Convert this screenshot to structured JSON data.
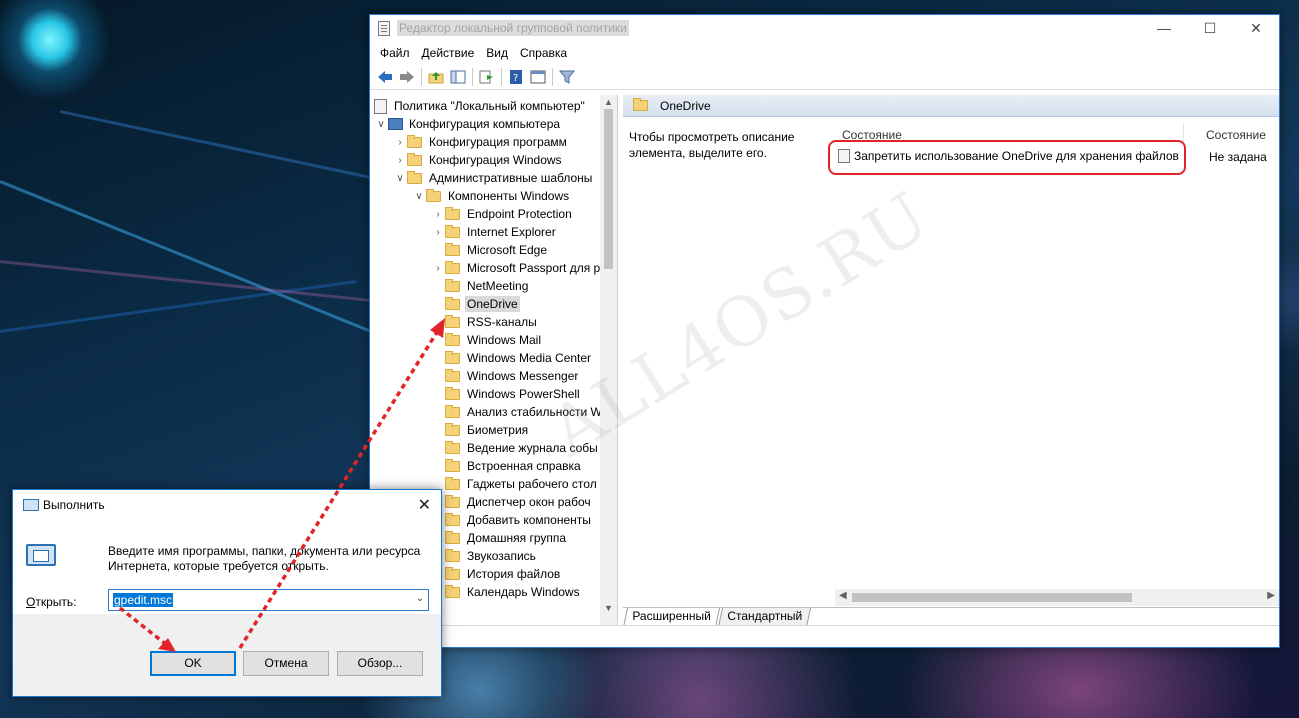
{
  "gp_window": {
    "title": "Редактор локальной групповой политики",
    "menu": [
      "Файл",
      "Действие",
      "Вид",
      "Справка"
    ],
    "tree": [
      {
        "label": "Политика \"Локальный компьютер\"",
        "level": 0,
        "expander": "",
        "icon": "policy"
      },
      {
        "label": "Конфигурация компьютера",
        "level": 1,
        "expander": "down",
        "icon": "computer"
      },
      {
        "label": "Конфигурация программ",
        "level": 2,
        "expander": "right",
        "icon": "folder"
      },
      {
        "label": "Конфигурация Windows",
        "level": 2,
        "expander": "right",
        "icon": "folder"
      },
      {
        "label": "Административные шаблоны",
        "level": 2,
        "expander": "down",
        "icon": "folder"
      },
      {
        "label": "Компоненты Windows",
        "level": 3,
        "expander": "down",
        "icon": "folder"
      },
      {
        "label": "Endpoint Protection",
        "level": 4,
        "expander": "right",
        "icon": "folder"
      },
      {
        "label": "Internet Explorer",
        "level": 4,
        "expander": "right",
        "icon": "folder"
      },
      {
        "label": "Microsoft Edge",
        "level": 4,
        "expander": "",
        "icon": "folder"
      },
      {
        "label": "Microsoft Passport для р",
        "level": 4,
        "expander": "right",
        "icon": "folder"
      },
      {
        "label": "NetMeeting",
        "level": 4,
        "expander": "",
        "icon": "folder"
      },
      {
        "label": "OneDrive",
        "level": 4,
        "expander": "",
        "icon": "folder",
        "selected": true
      },
      {
        "label": "RSS-каналы",
        "level": 4,
        "expander": "",
        "icon": "folder"
      },
      {
        "label": "Windows Mail",
        "level": 4,
        "expander": "",
        "icon": "folder"
      },
      {
        "label": "Windows Media Center",
        "level": 4,
        "expander": "",
        "icon": "folder"
      },
      {
        "label": "Windows Messenger",
        "level": 4,
        "expander": "",
        "icon": "folder"
      },
      {
        "label": "Windows PowerShell",
        "level": 4,
        "expander": "",
        "icon": "folder"
      },
      {
        "label": "Анализ стабильности W",
        "level": 4,
        "expander": "",
        "icon": "folder"
      },
      {
        "label": "Биометрия",
        "level": 4,
        "expander": "",
        "icon": "folder"
      },
      {
        "label": "Ведение журнала собы",
        "level": 4,
        "expander": "",
        "icon": "folder"
      },
      {
        "label": "Встроенная справка",
        "level": 4,
        "expander": "",
        "icon": "folder"
      },
      {
        "label": "Гаджеты рабочего стол",
        "level": 4,
        "expander": "",
        "icon": "folder"
      },
      {
        "label": "Диспетчер окон рабоч",
        "level": 4,
        "expander": "",
        "icon": "folder"
      },
      {
        "label": "Добавить компоненты",
        "level": 4,
        "expander": "",
        "icon": "folder"
      },
      {
        "label": "Домашняя группа",
        "level": 4,
        "expander": "",
        "icon": "folder"
      },
      {
        "label": "Звукозапись",
        "level": 4,
        "expander": "",
        "icon": "folder"
      },
      {
        "label": "История файлов",
        "level": 4,
        "expander": "",
        "icon": "folder"
      },
      {
        "label": "Календарь Windows",
        "level": 4,
        "expander": "",
        "icon": "folder"
      }
    ],
    "right_pane": {
      "header": "OneDrive",
      "description": "Чтобы просмотреть описание элемента, выделите его.",
      "col_setting": "Состояние",
      "col_state": "Состояние",
      "setting_label": "Запретить использование OneDrive для хранения файлов",
      "setting_state": "Не задана"
    },
    "tabs": [
      "Расширенный",
      "Стандартный"
    ]
  },
  "run_dialog": {
    "title": "Выполнить",
    "description": "Введите имя программы, папки, документа или ресурса Интернета, которые требуется открыть.",
    "open_label_prefix": "",
    "open_label_hotkey": "О",
    "open_label_rest": "ткрыть:",
    "input_value": "gpedit.msc",
    "ok": "OK",
    "cancel": "Отмена",
    "browse": "Обзор..."
  },
  "watermark": "ALL4OS.RU",
  "colors": {
    "annotation_red": "#e0242a",
    "accent_blue": "#0078d7"
  }
}
